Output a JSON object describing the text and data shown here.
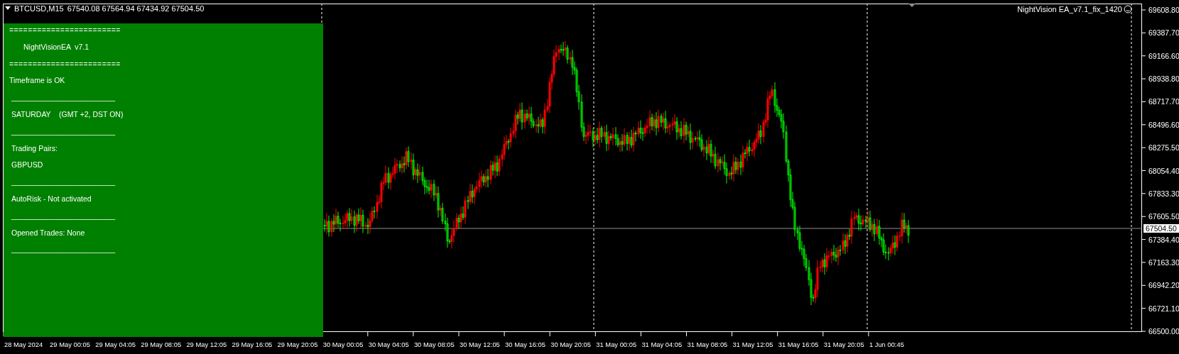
{
  "chart_header": {
    "symbol": "BTCUSD,M15",
    "ohlc": "67540.08 67564.94 67434.92 67504.50"
  },
  "expert_label": "NightVision EA_v7.1_fix_1420",
  "info_panel": {
    "lines": [
      {
        "kind": "rule",
        "text": "========================"
      },
      {
        "kind": "heading",
        "text": "NightVisionEA  v7.1"
      },
      {
        "kind": "rule",
        "text": "========================"
      },
      {
        "kind": "text",
        "text": "Timeframe is OK"
      },
      {
        "kind": "divider",
        "text": "_________________________"
      },
      {
        "kind": "item",
        "text": "SATURDAY    (GMT +2, DST ON)"
      },
      {
        "kind": "divider",
        "text": "_________________________"
      },
      {
        "kind": "item",
        "text": "Trading Pairs:"
      },
      {
        "kind": "item",
        "text": "GBPUSD"
      },
      {
        "kind": "divider",
        "text": "_________________________"
      },
      {
        "kind": "item",
        "text": "AutoRisk - Not activated"
      },
      {
        "kind": "divider",
        "text": "_________________________"
      },
      {
        "kind": "item",
        "text": "Opened Trades: None"
      },
      {
        "kind": "divider",
        "text": "_________________________"
      }
    ]
  },
  "price_axis": {
    "labels": [
      "69608.80",
      "69387.70",
      "69166.60",
      "68938.80",
      "68717.70",
      "68496.60",
      "68275.50",
      "68054.40",
      "67833.30",
      "67605.50",
      "67384.40",
      "67163.30",
      "66942.20",
      "66721.10",
      "66500.00"
    ],
    "current_price": "67504.50"
  },
  "time_axis": {
    "labels": [
      "28 May 2024",
      "29 May 00:05",
      "29 May 04:05",
      "29 May 08:05",
      "29 May 12:05",
      "29 May 16:05",
      "29 May 20:05",
      "30 May 00:05",
      "30 May 04:05",
      "30 May 08:05",
      "30 May 12:05",
      "30 May 16:05",
      "30 May 20:05",
      "31 May 00:05",
      "31 May 04:05",
      "31 May 08:05",
      "31 May 12:05",
      "31 May 16:05",
      "31 May 20:05",
      "1 Jun 00:45"
    ]
  }
}
